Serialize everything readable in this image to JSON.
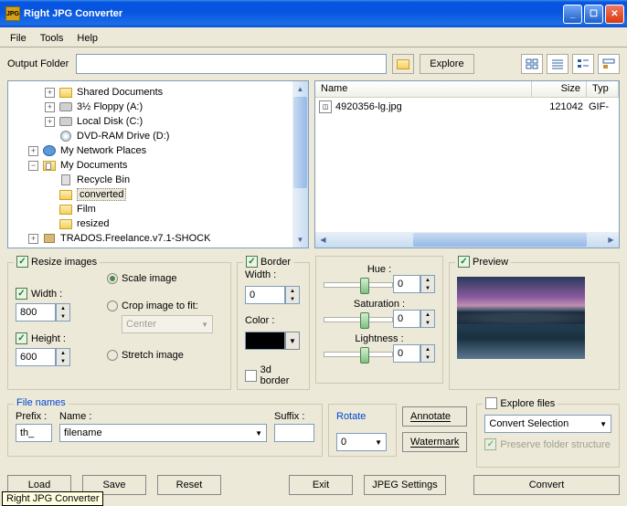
{
  "title": "Right JPG Converter",
  "menu": {
    "file": "File",
    "tools": "Tools",
    "help": "Help"
  },
  "toolbar": {
    "output_label": "Output Folder",
    "output_value": "",
    "explore": "Explore"
  },
  "tree": [
    {
      "indent": 2,
      "exp": "+",
      "icon": "folder",
      "label": "Shared Documents"
    },
    {
      "indent": 2,
      "exp": "+",
      "icon": "disk",
      "label": "3½ Floppy (A:)"
    },
    {
      "indent": 2,
      "exp": "+",
      "icon": "disk",
      "label": "Local Disk (C:)"
    },
    {
      "indent": 2,
      "exp": "",
      "icon": "cd",
      "label": "DVD-RAM Drive (D:)"
    },
    {
      "indent": 1,
      "exp": "+",
      "icon": "net",
      "label": "My Network Places"
    },
    {
      "indent": 1,
      "exp": "−",
      "icon": "docs",
      "label": "My Documents"
    },
    {
      "indent": 2,
      "exp": "",
      "icon": "bin",
      "label": "Recycle Bin"
    },
    {
      "indent": 2,
      "exp": "",
      "icon": "folder",
      "label": "converted",
      "sel": true
    },
    {
      "indent": 2,
      "exp": "",
      "icon": "folder",
      "label": "Film"
    },
    {
      "indent": 2,
      "exp": "",
      "icon": "folder",
      "label": "resized"
    },
    {
      "indent": 1,
      "exp": "+",
      "icon": "box",
      "label": "TRADOS.Freelance.v7.1-SHOCK"
    }
  ],
  "list": {
    "cols": {
      "name": "Name",
      "size": "Size",
      "type": "Typ"
    },
    "rows": [
      {
        "name": "4920356-lg.jpg",
        "size": "121042",
        "type": "GIF-"
      }
    ]
  },
  "resize": {
    "legend": "Resize images",
    "width_label": "Width :",
    "width_value": "800",
    "height_label": "Height :",
    "height_value": "600",
    "scale": "Scale image",
    "crop": "Crop image to fit:",
    "center": "Center",
    "stretch": "Stretch image"
  },
  "border": {
    "legend": "Border",
    "width_label": "Width :",
    "width_value": "0",
    "color_label": "Color :",
    "threeD": "3d border"
  },
  "hsl": {
    "hue": "Hue :",
    "hue_val": "0",
    "sat": "Saturation :",
    "sat_val": "0",
    "light": "Lightness :",
    "light_val": "0"
  },
  "preview": {
    "legend": "Preview"
  },
  "filenames": {
    "legend": "File names",
    "prefix_label": "Prefix :",
    "prefix_value": "th_",
    "name_label": "Name :",
    "name_value": "filename",
    "suffix_label": "Suffix :",
    "suffix_value": ""
  },
  "rotate": {
    "legend": "Rotate",
    "value": "0"
  },
  "side": {
    "annotate": "Annotate",
    "watermark": "Watermark"
  },
  "explore": {
    "legend": "Explore files",
    "combo": "Convert Selection",
    "preserve": "Preserve folder structure"
  },
  "bottom": {
    "load": "Load",
    "save": "Save",
    "reset": "Reset",
    "exit": "Exit",
    "jpeg": "JPEG Settings",
    "convert": "Convert"
  },
  "status": "Right JPG Converter"
}
